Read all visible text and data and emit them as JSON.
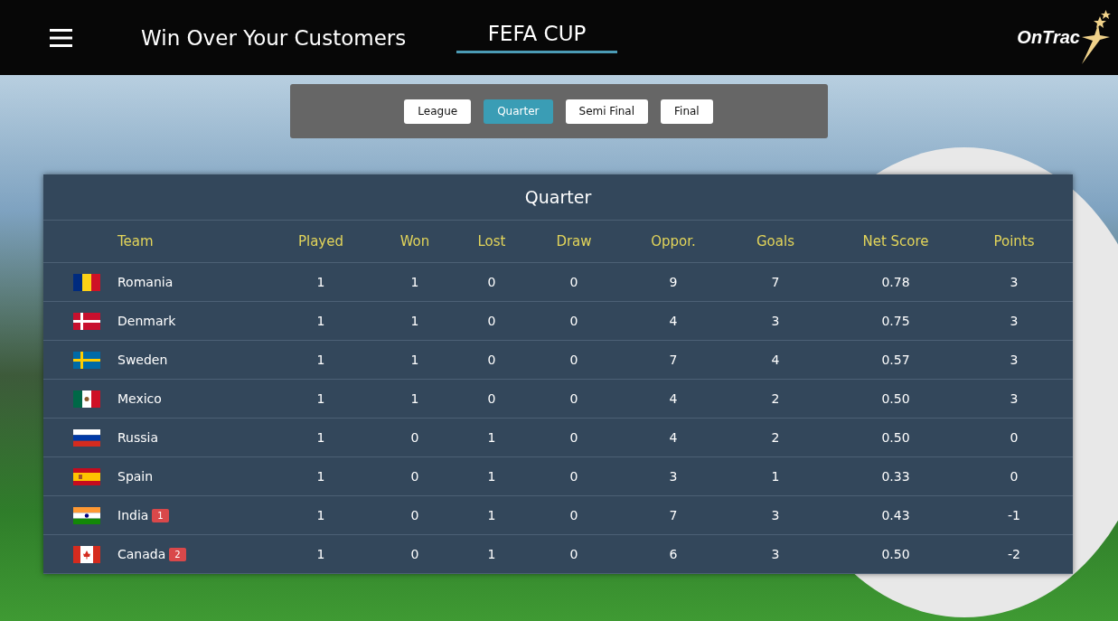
{
  "header": {
    "title": "Win Over Your Customers",
    "tab": "FEFA CUP",
    "logo": "OnTrac"
  },
  "stages": [
    {
      "label": "League",
      "selected": false
    },
    {
      "label": "Quarter",
      "selected": true
    },
    {
      "label": "Semi Final",
      "selected": false
    },
    {
      "label": "Final",
      "selected": false
    }
  ],
  "table": {
    "title": "Quarter",
    "columns": [
      "Team",
      "Played",
      "Won",
      "Lost",
      "Draw",
      "Oppor.",
      "Goals",
      "Net Score",
      "Points"
    ],
    "rows": [
      {
        "kind": "romania",
        "cells": [
          "Romania",
          "1",
          "1",
          "0",
          "0",
          "9",
          "7",
          "0.78",
          "3"
        ]
      },
      {
        "kind": "denmark",
        "cells": [
          "Denmark",
          "1",
          "1",
          "0",
          "0",
          "4",
          "3",
          "0.75",
          "3"
        ]
      },
      {
        "kind": "sweden",
        "cells": [
          "Sweden",
          "1",
          "1",
          "0",
          "0",
          "7",
          "4",
          "0.57",
          "3"
        ]
      },
      {
        "kind": "mexico",
        "cells": [
          "Mexico",
          "1",
          "1",
          "0",
          "0",
          "4",
          "2",
          "0.50",
          "3"
        ]
      },
      {
        "kind": "russia",
        "cells": [
          "Russia",
          "1",
          "0",
          "1",
          "0",
          "4",
          "2",
          "0.50",
          "0"
        ]
      },
      {
        "kind": "spain",
        "cells": [
          "Spain",
          "1",
          "0",
          "1",
          "0",
          "3",
          "1",
          "0.33",
          "0"
        ]
      },
      {
        "kind": "india",
        "badge": "1",
        "cells": [
          "India",
          "1",
          "0",
          "1",
          "0",
          "7",
          "3",
          "0.43",
          "-1"
        ]
      },
      {
        "kind": "canada",
        "badge": "2",
        "cells": [
          "Canada",
          "1",
          "0",
          "1",
          "0",
          "6",
          "3",
          "0.50",
          "-2"
        ]
      }
    ]
  }
}
